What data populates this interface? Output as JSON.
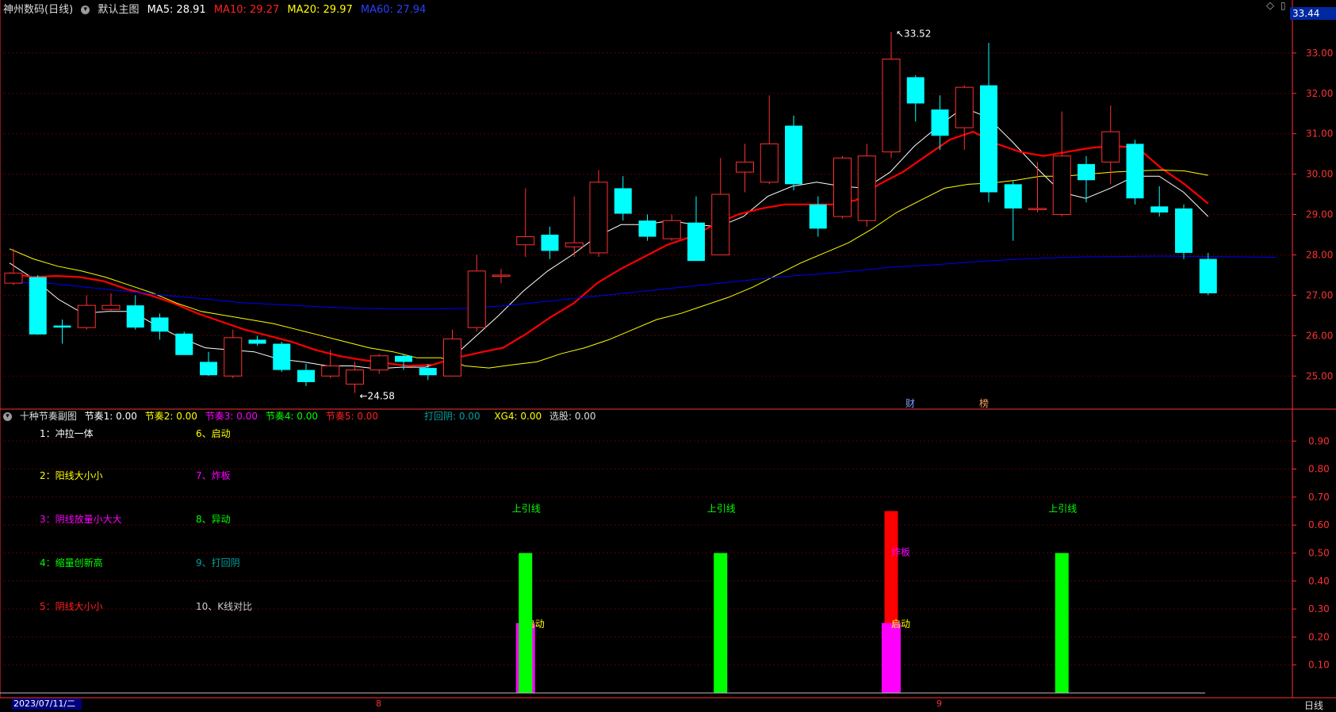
{
  "main_header": {
    "title": "神州数码(日线)",
    "chart_name": "默认主图",
    "ma5": "MA5: 28.91",
    "ma10": "MA10: 29.27",
    "ma20": "MA20: 29.97",
    "ma60": "MA60: 27.94"
  },
  "price_badge": "33.44",
  "sub_header": {
    "title": "十种节奏副图",
    "j1": "节奏1: 0.00",
    "j2": "节奏2: 0.00",
    "j3": "节奏3: 0.00",
    "j4": "节奏4: 0.00",
    "j5": "节奏5: 0.00",
    "dhy": "打回阴: 0.00",
    "xg4": "XG4: 0.00",
    "xg": "选股: 0.00"
  },
  "legend_items": [
    {
      "text": "1：冲拉一体",
      "color": "#ffffff"
    },
    {
      "text": "6、启动",
      "color": "#ffff00"
    },
    {
      "text": "2：阳线大小小",
      "color": "#ffff00"
    },
    {
      "text": "7、炸板",
      "color": "#ff00ff"
    },
    {
      "text": "3：阴线放量小大大",
      "color": "#ff00ff"
    },
    {
      "text": "8、异动",
      "color": "#00ff00"
    },
    {
      "text": "4：缩量创新高",
      "color": "#00ff00"
    },
    {
      "text": "9、打回阴",
      "color": "#00a0a0"
    },
    {
      "text": "5：阴线大小小",
      "color": "#ff2020"
    },
    {
      "text": "10、K线对比",
      "color": "#cccccc"
    }
  ],
  "markers": {
    "cai": "财",
    "bang": "榜"
  },
  "bottom": {
    "date": "2023/07/11/二",
    "m8": "8",
    "m9": "9",
    "period": "日线"
  },
  "colors": {
    "up": "#ff3030",
    "down": "#00ffff",
    "ma5": "#ffffff",
    "ma10": "#ff0000",
    "ma20": "#ffff00",
    "ma60": "#0000ff",
    "grid": "#5a0000",
    "axis": "#ff3030"
  },
  "chart_data": [
    {
      "type": "candlestick",
      "title": "神州数码(日线)",
      "ylim": [
        24.2,
        33.9
      ],
      "y_ticks": [
        "33.00",
        "32.00",
        "31.00",
        "30.00",
        "29.00",
        "28.00",
        "27.00",
        "26.00",
        "25.00"
      ],
      "annotations": [
        {
          "text": "33.52",
          "index": 36
        },
        {
          "text": "24.58",
          "index": 14
        }
      ],
      "candles": [
        {
          "o": 27.3,
          "h": 28.15,
          "l": 27.25,
          "c": 27.55
        },
        {
          "o": 27.45,
          "h": 27.5,
          "l": 26.02,
          "c": 26.03
        },
        {
          "o": 26.25,
          "h": 26.4,
          "l": 25.8,
          "c": 26.2
        },
        {
          "o": 26.2,
          "h": 27.0,
          "l": 26.15,
          "c": 26.75
        },
        {
          "o": 26.65,
          "h": 27.05,
          "l": 26.6,
          "c": 26.75
        },
        {
          "o": 26.75,
          "h": 27.0,
          "l": 26.15,
          "c": 26.2
        },
        {
          "o": 26.45,
          "h": 26.55,
          "l": 25.9,
          "c": 26.1
        },
        {
          "o": 26.05,
          "h": 26.1,
          "l": 25.55,
          "c": 25.52
        },
        {
          "o": 25.35,
          "h": 25.6,
          "l": 25.0,
          "c": 25.02
        },
        {
          "o": 25.0,
          "h": 26.15,
          "l": 24.95,
          "c": 25.95
        },
        {
          "o": 25.9,
          "h": 26.0,
          "l": 25.75,
          "c": 25.8
        },
        {
          "o": 25.8,
          "h": 25.85,
          "l": 25.1,
          "c": 25.15
        },
        {
          "o": 25.15,
          "h": 25.3,
          "l": 24.75,
          "c": 24.85
        },
        {
          "o": 25.0,
          "h": 25.65,
          "l": 24.95,
          "c": 25.25
        },
        {
          "o": 24.8,
          "h": 25.35,
          "l": 24.58,
          "c": 25.15
        },
        {
          "o": 25.15,
          "h": 25.55,
          "l": 25.05,
          "c": 25.5
        },
        {
          "o": 25.5,
          "h": 25.55,
          "l": 25.15,
          "c": 25.35
        },
        {
          "o": 25.2,
          "h": 25.3,
          "l": 24.9,
          "c": 25.02
        },
        {
          "o": 25.0,
          "h": 26.15,
          "l": 25.0,
          "c": 25.92
        },
        {
          "o": 26.2,
          "h": 28.0,
          "l": 26.1,
          "c": 27.6
        },
        {
          "o": 27.5,
          "h": 27.65,
          "l": 27.3,
          "c": 27.5
        },
        {
          "o": 28.25,
          "h": 29.65,
          "l": 27.95,
          "c": 28.45
        },
        {
          "o": 28.5,
          "h": 28.7,
          "l": 27.9,
          "c": 28.1
        },
        {
          "o": 28.2,
          "h": 29.45,
          "l": 27.95,
          "c": 28.3
        },
        {
          "o": 28.05,
          "h": 30.1,
          "l": 27.95,
          "c": 29.8
        },
        {
          "o": 29.65,
          "h": 29.95,
          "l": 28.85,
          "c": 29.02
        },
        {
          "o": 28.85,
          "h": 29.0,
          "l": 28.35,
          "c": 28.45
        },
        {
          "o": 28.4,
          "h": 29.0,
          "l": 28.35,
          "c": 28.85
        },
        {
          "o": 28.8,
          "h": 29.45,
          "l": 27.85,
          "c": 27.85
        },
        {
          "o": 28.0,
          "h": 30.4,
          "l": 28.0,
          "c": 29.5
        },
        {
          "o": 30.05,
          "h": 30.75,
          "l": 29.55,
          "c": 30.3
        },
        {
          "o": 29.8,
          "h": 31.95,
          "l": 29.75,
          "c": 30.75
        },
        {
          "o": 31.2,
          "h": 31.45,
          "l": 29.6,
          "c": 29.75
        },
        {
          "o": 29.25,
          "h": 29.45,
          "l": 28.45,
          "c": 28.65
        },
        {
          "o": 28.95,
          "h": 30.45,
          "l": 28.9,
          "c": 30.4
        },
        {
          "o": 28.85,
          "h": 30.75,
          "l": 28.7,
          "c": 30.45
        },
        {
          "o": 30.55,
          "h": 33.52,
          "l": 30.4,
          "c": 32.85
        },
        {
          "o": 32.4,
          "h": 32.45,
          "l": 31.3,
          "c": 31.75
        },
        {
          "o": 31.6,
          "h": 31.95,
          "l": 30.6,
          "c": 30.95
        },
        {
          "o": 31.15,
          "h": 32.2,
          "l": 30.6,
          "c": 32.15
        },
        {
          "o": 32.2,
          "h": 33.25,
          "l": 29.3,
          "c": 29.55
        },
        {
          "o": 29.75,
          "h": 29.85,
          "l": 28.35,
          "c": 29.15
        },
        {
          "o": 29.15,
          "h": 30.3,
          "l": 29.05,
          "c": 29.15
        },
        {
          "o": 29.0,
          "h": 31.55,
          "l": 28.95,
          "c": 30.45
        },
        {
          "o": 30.25,
          "h": 30.45,
          "l": 29.3,
          "c": 29.85
        },
        {
          "o": 30.3,
          "h": 31.7,
          "l": 29.75,
          "c": 31.05
        },
        {
          "o": 30.75,
          "h": 30.85,
          "l": 29.25,
          "c": 29.4
        },
        {
          "o": 29.2,
          "h": 29.7,
          "l": 28.95,
          "c": 29.05
        },
        {
          "o": 29.15,
          "h": 29.25,
          "l": 27.9,
          "c": 28.05
        },
        {
          "o": 27.9,
          "h": 28.05,
          "l": 27.0,
          "c": 27.05
        }
      ],
      "series": [
        {
          "name": "MA5",
          "values": [
            27.8,
            27.4,
            26.9,
            26.55,
            26.6,
            26.6,
            26.25,
            25.95,
            25.7,
            25.65,
            25.6,
            25.42,
            25.35,
            25.25,
            25.25,
            25.18,
            25.22,
            25.22,
            25.4,
            25.95,
            26.5,
            27.1,
            27.6,
            28.0,
            28.45,
            28.75,
            28.75,
            28.85,
            28.75,
            28.7,
            28.95,
            29.45,
            29.7,
            29.8,
            29.7,
            29.65,
            30.05,
            30.7,
            31.2,
            31.65,
            31.4,
            30.8,
            30.15,
            29.55,
            29.4,
            29.65,
            29.95,
            29.95,
            29.55,
            28.95
          ]
        },
        {
          "name": "MA10",
          "values": [
            27.55,
            27.45,
            27.48,
            27.45,
            27.35,
            27.15,
            27.0,
            26.8,
            26.55,
            26.35,
            26.15,
            26.0,
            25.85,
            25.65,
            25.5,
            25.4,
            25.32,
            25.25,
            25.28,
            25.45,
            25.58,
            25.7,
            26.05,
            26.45,
            26.8,
            27.3,
            27.65,
            27.95,
            28.25,
            28.45,
            28.75,
            29.0,
            29.15,
            29.25,
            29.25,
            29.25,
            29.35,
            29.75,
            30.05,
            30.45,
            30.85,
            31.05,
            30.75,
            30.55,
            30.45,
            30.55,
            30.65,
            30.7,
            30.65,
            30.15,
            29.75,
            29.27
          ]
        },
        {
          "name": "MA20",
          "values": [
            28.15,
            27.9,
            27.72,
            27.6,
            27.45,
            27.25,
            27.05,
            26.8,
            26.6,
            26.5,
            26.4,
            26.3,
            26.15,
            26.0,
            25.85,
            25.7,
            25.6,
            25.45,
            25.45,
            25.25,
            25.2,
            25.28,
            25.35,
            25.55,
            25.7,
            25.9,
            26.15,
            26.4,
            26.55,
            26.75,
            26.95,
            27.2,
            27.5,
            27.8,
            28.05,
            28.3,
            28.65,
            29.05,
            29.35,
            29.65,
            29.75,
            29.78,
            29.85,
            29.95,
            29.95,
            30.0,
            30.05,
            30.08,
            30.1,
            30.08,
            29.97
          ]
        },
        {
          "name": "MA60",
          "values": [
            27.32,
            27.3,
            27.2,
            27.1,
            27.0,
            26.92,
            26.82,
            26.77,
            26.72,
            26.68,
            26.66,
            26.66,
            26.68,
            26.75,
            26.85,
            26.95,
            27.05,
            27.15,
            27.25,
            27.35,
            27.45,
            27.52,
            27.6,
            27.7,
            27.75,
            27.82,
            27.88,
            27.92,
            27.95,
            27.96,
            27.97,
            27.96,
            27.95,
            27.94
          ]
        }
      ]
    },
    {
      "type": "bar",
      "title": "十种节奏副图",
      "ylim": [
        0,
        1.0
      ],
      "y_ticks": [
        "0.90",
        "0.80",
        "0.70",
        "0.60",
        "0.50",
        "0.40",
        "0.30",
        "0.20",
        "0.10"
      ],
      "bars": [
        {
          "index": 21,
          "value": 0.25,
          "color": "#ff00ff",
          "label": "启动",
          "label_color": "#ffff00"
        },
        {
          "index": 21,
          "value": 0.5,
          "color": "#00ff00",
          "label": "上引线",
          "label_color": "#00ff00"
        },
        {
          "index": 29,
          "value": 0.5,
          "color": "#00ff00",
          "label": "上引线",
          "label_color": "#00ff00"
        },
        {
          "index": 36,
          "value": 0.65,
          "color": "#ff0000",
          "label": "炸板",
          "label_color": "#ff00ff"
        },
        {
          "index": 36,
          "value": 0.25,
          "color": "#ff00ff",
          "label": "启动",
          "label_color": "#ffff00"
        },
        {
          "index": 43,
          "value": 0.5,
          "color": "#00ff00",
          "label": "上引线",
          "label_color": "#00ff00"
        }
      ]
    }
  ]
}
